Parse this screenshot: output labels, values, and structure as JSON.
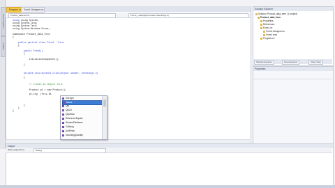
{
  "tabs": [
    "Program.cs",
    "Form1.Designer.cs"
  ],
  "nav": {
    "left": "Product_data.Form1",
    "right": "Form1_Load(object sender, EventArgs e)"
  },
  "code_lines": [
    "using System;",
    "using System.Linq;",
    "using System.Text;",
    "using System.Windows.Forms;",
    "",
    "namespace Product_data_form",
    "{",
    "    public partial class Form1 : Form",
    "    {",
    "        public Form1()",
    "        {",
    "            InitializeComponent();",
    "        }",
    "",
    "        private void button1_Click(object sender, EventArgs e)",
    "        {",
    "            // Create an Object form",
    "",
    "            Product p1 = new Product();",
    "            p1.ing  (fs=s.IB",
    "",
    "        }",
    "    }",
    "}"
  ],
  "autocomplete": {
    "items": [
      "GetType",
      "Name",
      "Qty",
      "Qty2d",
      "Qty2Disc",
      "ReferenceEquals",
      "StudentFileName",
      "ToString",
      "UnitPrice",
      "IncomingQuantity"
    ],
    "selected": 1
  },
  "solution_explorer": {
    "title": "Solution Explorer",
    "items": [
      {
        "label": "Solution 'Product_data_form' (1 project)",
        "indent": 0
      },
      {
        "label": "Product_data_form",
        "indent": 1
      },
      {
        "label": "Properties",
        "indent": 2
      },
      {
        "label": "References",
        "indent": 2
      },
      {
        "label": "Form1.cs",
        "indent": 2
      },
      {
        "label": "Form1.Designer.cs",
        "indent": 3
      },
      {
        "label": "Form1.resx",
        "indent": 3
      },
      {
        "label": "Program.cs",
        "indent": 2
      }
    ],
    "tabs": [
      "Solution Explorer",
      "Team Explorer",
      "Class View"
    ]
  },
  "properties": {
    "title": "Properties"
  },
  "output": {
    "title": "Output",
    "show_label": "Show output from:",
    "source": "Debug"
  },
  "left_tabs": [
    "Server Explorer",
    "Toolbox"
  ]
}
